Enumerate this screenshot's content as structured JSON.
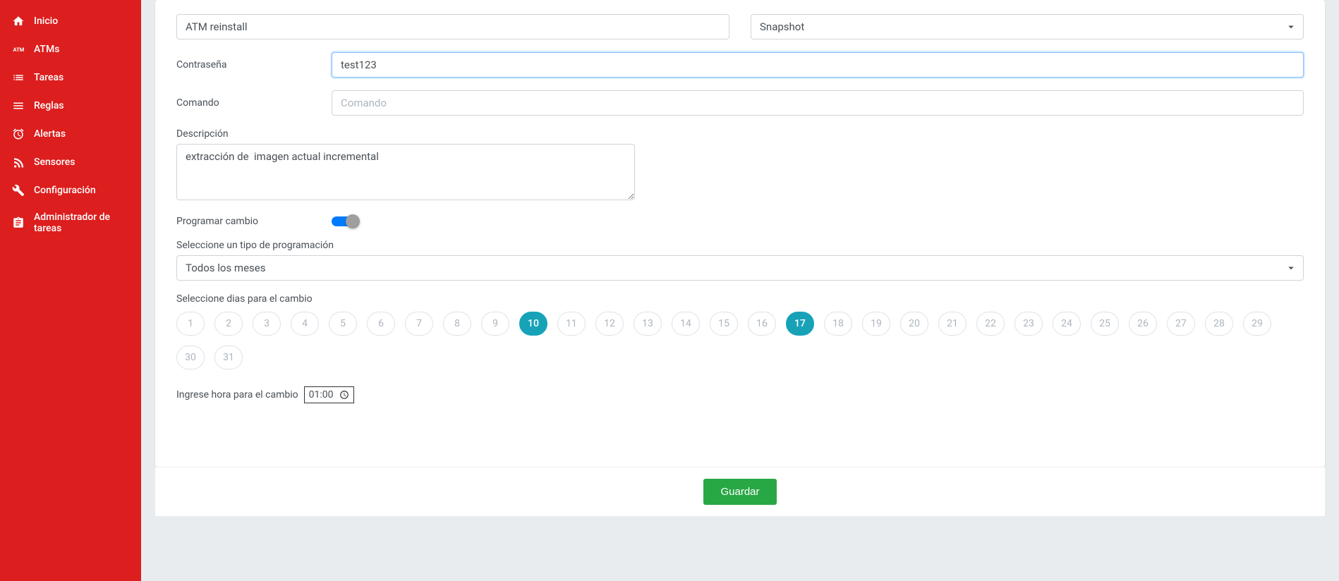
{
  "sidebar": {
    "items": [
      {
        "label": "Inicio",
        "icon": "home-icon"
      },
      {
        "label": "ATMs",
        "icon": "atm-icon"
      },
      {
        "label": "Tareas",
        "icon": "list-icon"
      },
      {
        "label": "Reglas",
        "icon": "lines-icon"
      },
      {
        "label": "Alertas",
        "icon": "alarm-icon"
      },
      {
        "label": "Sensores",
        "icon": "rss-icon"
      },
      {
        "label": "Configuración",
        "icon": "wrench-icon"
      },
      {
        "label": "Administrador de tareas",
        "icon": "clipboard-icon"
      }
    ]
  },
  "form": {
    "name_value": "ATM reinstall",
    "type_value": "Snapshot",
    "password_label": "Contraseña",
    "password_value": "test123",
    "command_label": "Comando",
    "command_placeholder": "Comando",
    "command_value": "",
    "description_label": "Descripción",
    "description_value": "extracción de  imagen actual incremental",
    "schedule_toggle_label": "Programar cambio",
    "schedule_toggle_on": true,
    "schedule_type_label": "Seleccione un tipo de programación",
    "schedule_type_value": "Todos los meses",
    "days_label": "Seleccione dias para el cambio",
    "days": [
      1,
      2,
      3,
      4,
      5,
      6,
      7,
      8,
      9,
      10,
      11,
      12,
      13,
      14,
      15,
      16,
      17,
      18,
      19,
      20,
      21,
      22,
      23,
      24,
      25,
      26,
      27,
      28,
      29,
      30,
      31
    ],
    "days_selected": [
      10,
      17
    ],
    "time_label": "Ingrese hora para el cambio",
    "time_value": "01:00",
    "save_label": "Guardar"
  }
}
